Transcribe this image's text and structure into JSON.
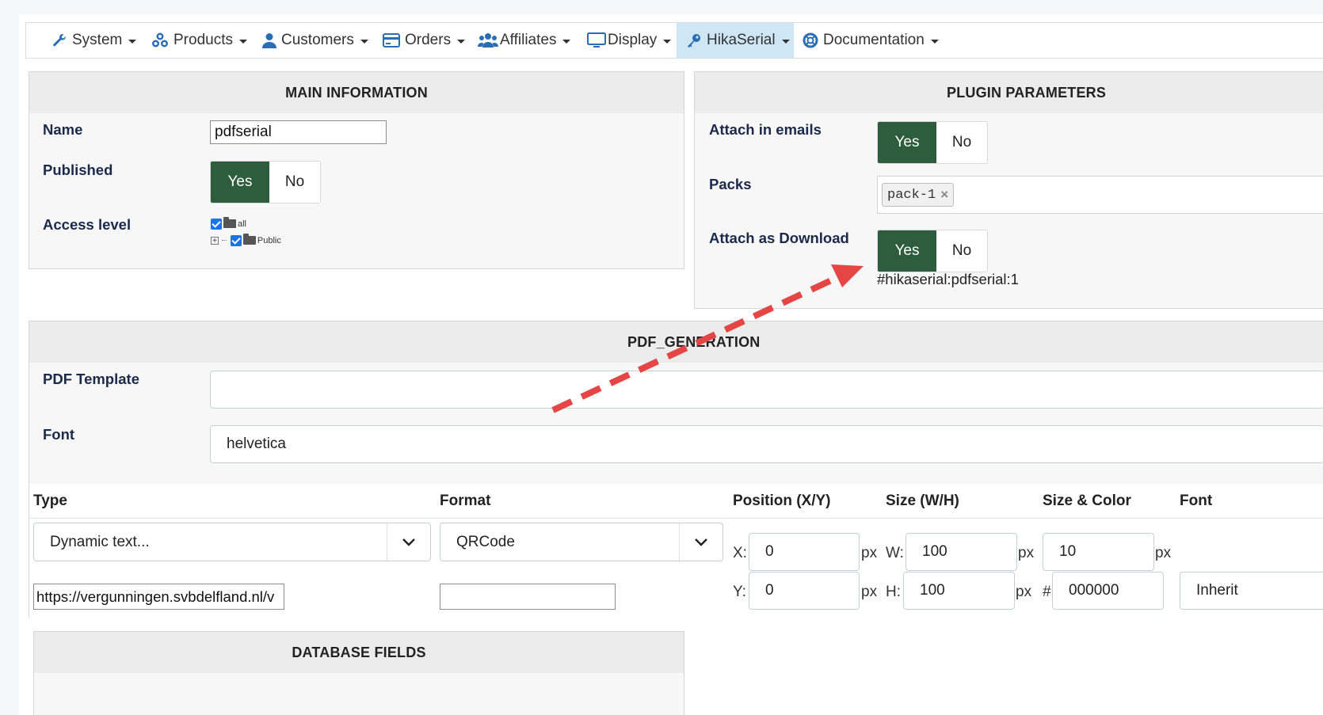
{
  "nav": {
    "items": [
      {
        "label": "System",
        "icon": "wrench-icon"
      },
      {
        "label": "Products",
        "icon": "cubes-icon"
      },
      {
        "label": "Customers",
        "icon": "user-icon"
      },
      {
        "label": "Orders",
        "icon": "credit-card-icon"
      },
      {
        "label": "Affiliates",
        "icon": "users-icon"
      },
      {
        "label": "Display",
        "icon": "monitor-icon"
      },
      {
        "label": "HikaSerial",
        "icon": "key-icon",
        "active": true
      },
      {
        "label": "Documentation",
        "icon": "lifebuoy-icon"
      }
    ]
  },
  "main_info": {
    "title": "MAIN INFORMATION",
    "name_label": "Name",
    "name_value": "pdfserial",
    "published_label": "Published",
    "yes": "Yes",
    "no": "No",
    "access_label": "Access level",
    "access_tree": [
      {
        "label": "all"
      },
      {
        "label": "Public"
      }
    ]
  },
  "plugin": {
    "title": "PLUGIN PARAMETERS",
    "attach_emails_label": "Attach in emails",
    "packs_label": "Packs",
    "pack_tag": "pack-1",
    "attach_download_label": "Attach as Download",
    "tag_code": "#hikaserial:pdfserial:1",
    "yes": "Yes",
    "no": "No"
  },
  "pdf": {
    "title": "PDF_GENERATION",
    "template_label": "PDF Template",
    "template_value": "",
    "font_label": "Font",
    "font_value": "helvetica",
    "columns": {
      "type": "Type",
      "format": "Format",
      "position": "Position (X/Y)",
      "size": "Size (W/H)",
      "size_color": "Size & Color",
      "font": "Font"
    },
    "row": {
      "type_value": "Dynamic text...",
      "format_value": "QRCode",
      "url_value": "https://vergunningen.svbdelfland.nl/v",
      "format_extra": "",
      "x_label": "X:",
      "x_value": "0",
      "y_label": "Y:",
      "y_value": "0",
      "w_label": "W:",
      "w_value": "100",
      "h_label": "H:",
      "h_value": "100",
      "px": "px",
      "size_value": "10",
      "hash": "#",
      "color_value": "000000",
      "font_value": "Inherit"
    }
  },
  "db": {
    "title": "DATABASE FIELDS"
  },
  "colors": {
    "toggle_on": "#2e5d3d",
    "nav_active": "#cfe6f5",
    "arrow": "#e64545"
  }
}
